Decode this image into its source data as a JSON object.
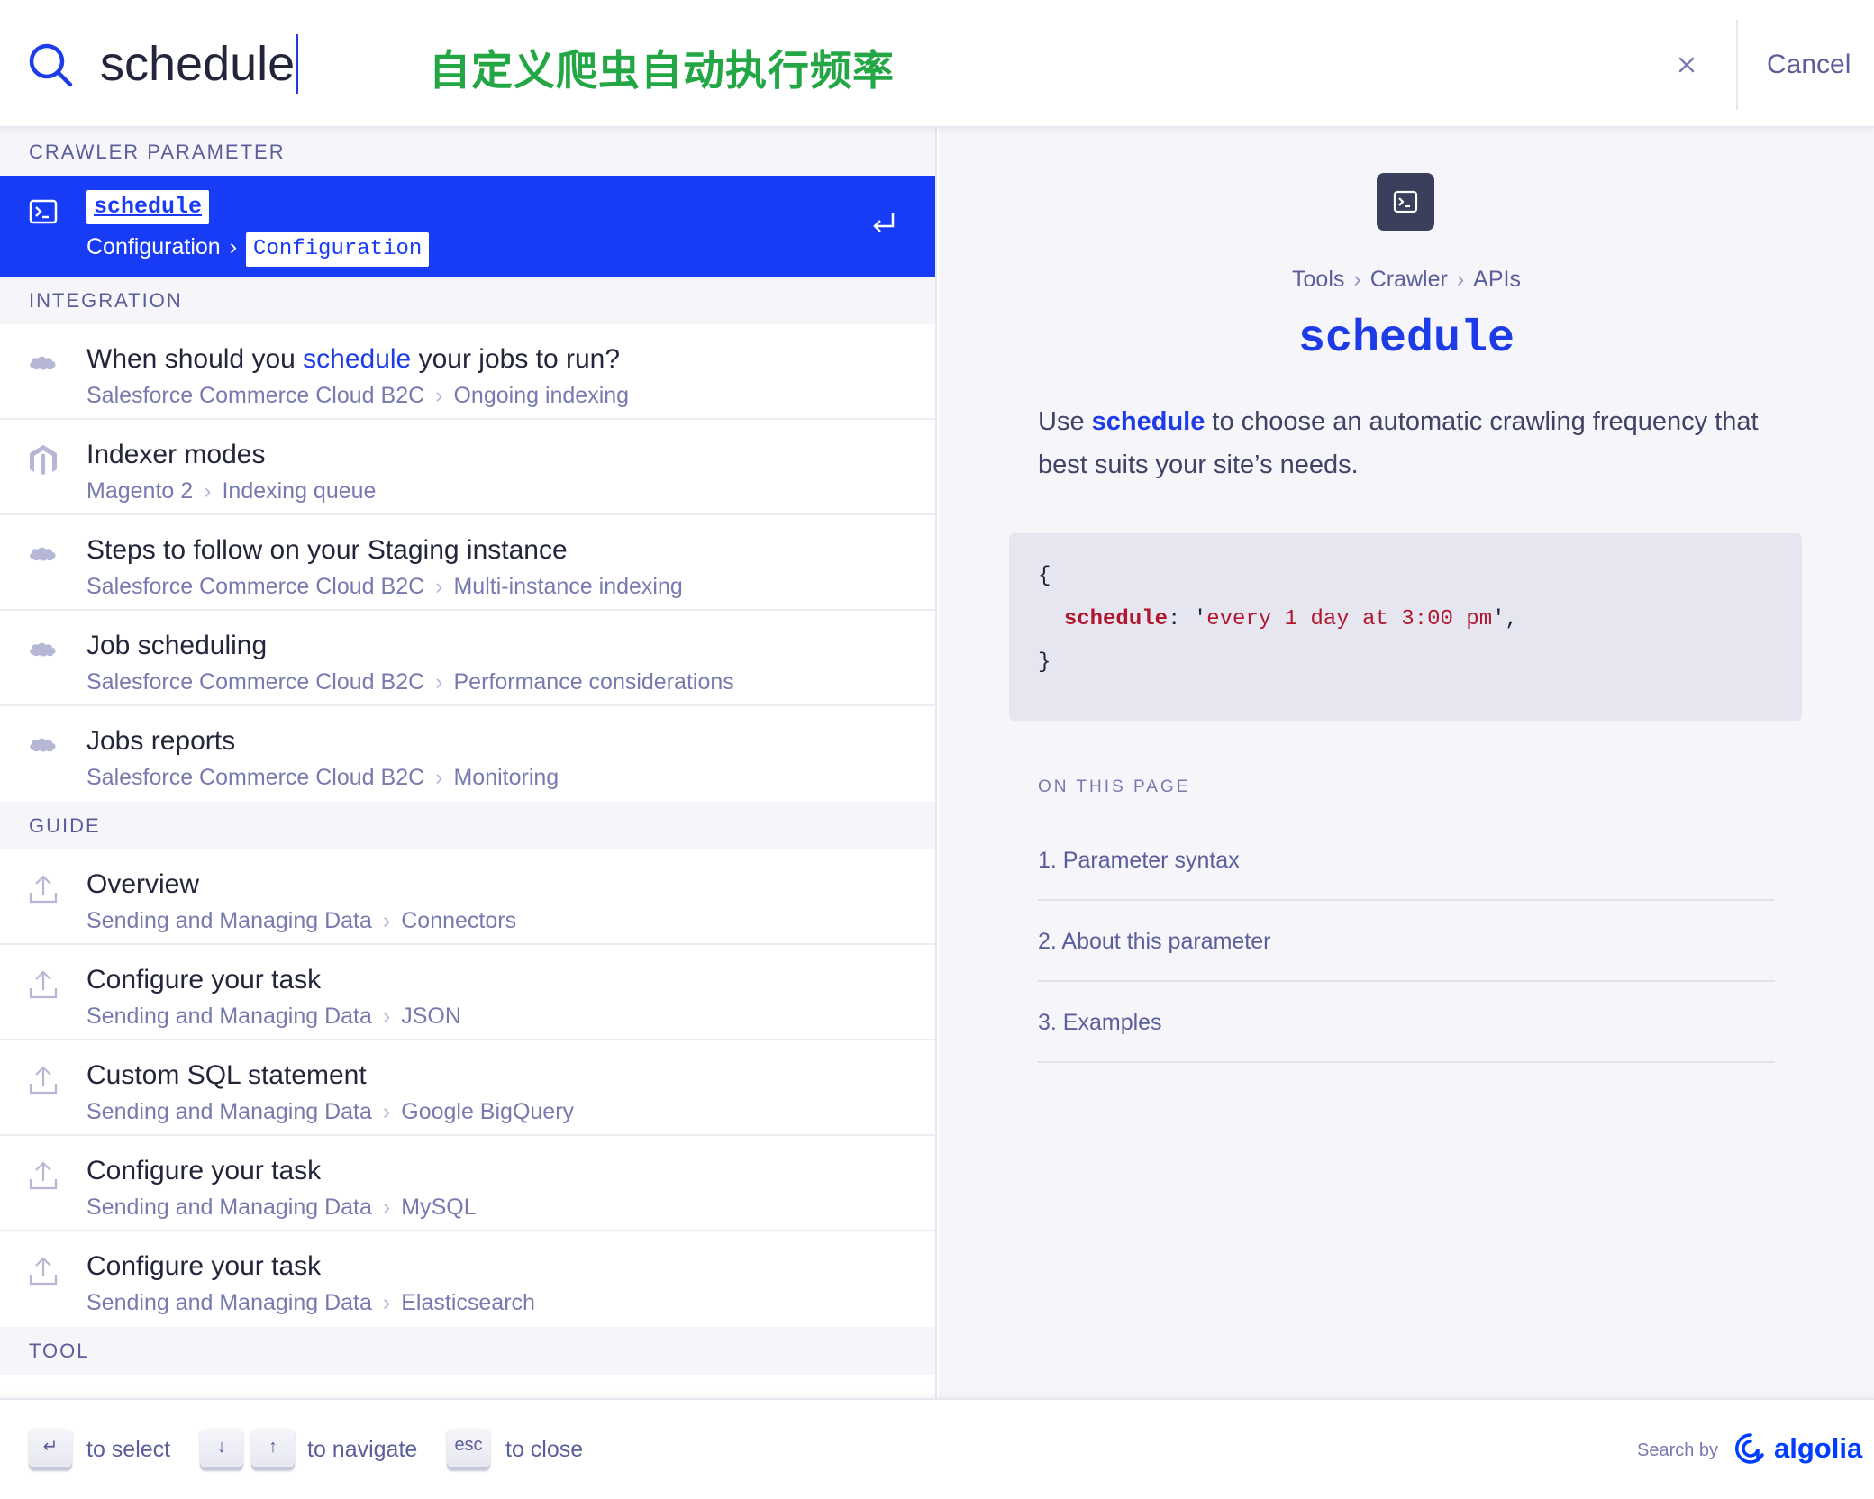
{
  "search": {
    "query": "schedule",
    "annotation": "自定义爬虫自动执行频率",
    "cancel_label": "Cancel"
  },
  "results": {
    "selected_section": "CRAWLER PARAMETER",
    "selected": {
      "title": "schedule",
      "path_1": "Configuration",
      "path_2": "Configuration"
    },
    "integration_section": "INTEGRATION",
    "integration": [
      {
        "icon": "salesforce-icon",
        "title_pre": "When should you ",
        "title_hl": "schedule",
        "title_post": " your jobs to run?",
        "path_1": "Salesforce Commerce Cloud B2C",
        "path_2": "Ongoing indexing"
      },
      {
        "icon": "magento-icon",
        "title_pre": "Indexer modes",
        "title_hl": "",
        "title_post": "",
        "path_1": "Magento 2",
        "path_2": "Indexing queue"
      },
      {
        "icon": "salesforce-icon",
        "title_pre": "Steps to follow on your Staging instance",
        "title_hl": "",
        "title_post": "",
        "path_1": "Salesforce Commerce Cloud B2C",
        "path_2": "Multi-instance indexing"
      },
      {
        "icon": "salesforce-icon",
        "title_pre": "Job scheduling",
        "title_hl": "",
        "title_post": "",
        "path_1": "Salesforce Commerce Cloud B2C",
        "path_2": "Performance considerations"
      },
      {
        "icon": "salesforce-icon",
        "title_pre": "Jobs reports",
        "title_hl": "",
        "title_post": "",
        "path_1": "Salesforce Commerce Cloud B2C",
        "path_2": "Monitoring"
      }
    ],
    "guide_section": "GUIDE",
    "guide": [
      {
        "title": "Overview",
        "path_1": "Sending and Managing Data",
        "path_2": "Connectors"
      },
      {
        "title": "Configure your task",
        "path_1": "Sending and Managing Data",
        "path_2": "JSON"
      },
      {
        "title": "Custom SQL statement",
        "path_1": "Sending and Managing Data",
        "path_2": "Google BigQuery"
      },
      {
        "title": "Configure your task",
        "path_1": "Sending and Managing Data",
        "path_2": "MySQL"
      },
      {
        "title": "Configure your task",
        "path_1": "Sending and Managing Data",
        "path_2": "Elasticsearch"
      }
    ],
    "tool_section": "TOOL"
  },
  "preview": {
    "breadcrumb": [
      "Tools",
      "Crawler",
      "APIs"
    ],
    "title": "schedule",
    "desc_pre": "Use ",
    "desc_hl": "schedule",
    "desc_post": " to choose an automatic crawling frequency that best suits your site’s needs.",
    "code": {
      "open": "{",
      "key": "schedule",
      "colon": ": '",
      "value": "every 1 day at 3:00 pm",
      "end": "',",
      "close": "}"
    },
    "toc_title": "ON THIS PAGE",
    "toc": [
      "1. Parameter syntax",
      "2. About this parameter",
      "3. Examples"
    ]
  },
  "footer": {
    "enter_key": "↵",
    "select_label": "to select",
    "down_key": "↓",
    "up_key": "↑",
    "navigate_label": "to navigate",
    "esc_key": "esc",
    "close_label": "to close",
    "search_by": "Search by",
    "brand": "algolia"
  },
  "colors": {
    "accent": "#183bf5",
    "highlight": "#1d3ce8",
    "annotation": "#22a744",
    "code_key": "#b0172e"
  }
}
